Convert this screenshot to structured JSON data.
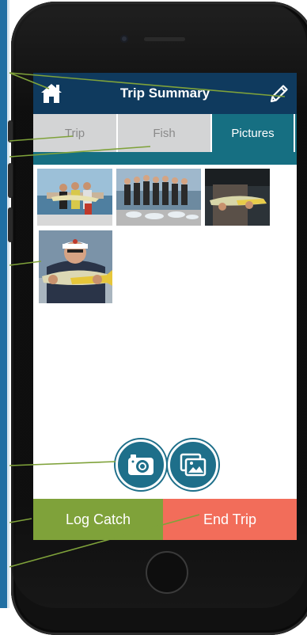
{
  "header": {
    "title": "Trip Summary",
    "home_icon": "home-icon",
    "edit_icon": "pencil-icon"
  },
  "tabs": [
    {
      "label": "Trip",
      "active": false
    },
    {
      "label": "Fish",
      "active": false
    },
    {
      "label": "Pictures",
      "active": true
    }
  ],
  "photos": [
    {
      "subject": "three anglers holding fish on a boat"
    },
    {
      "subject": "group of people with fish on a dock"
    },
    {
      "subject": "person holding a yellowtail snapper"
    },
    {
      "subject": "man in white cap holding a yellowtail snapper"
    }
  ],
  "actions": {
    "camera_icon": "camera-icon",
    "gallery_icon": "photo-gallery-icon"
  },
  "bottom": {
    "log_catch_label": "Log Catch",
    "end_trip_label": "End Trip"
  },
  "colors": {
    "header": "#0f3a5e",
    "tab_bar": "#166f82",
    "log_catch": "#7fa23a",
    "end_trip": "#f26d5a",
    "callout_line": "#7fa23a"
  }
}
